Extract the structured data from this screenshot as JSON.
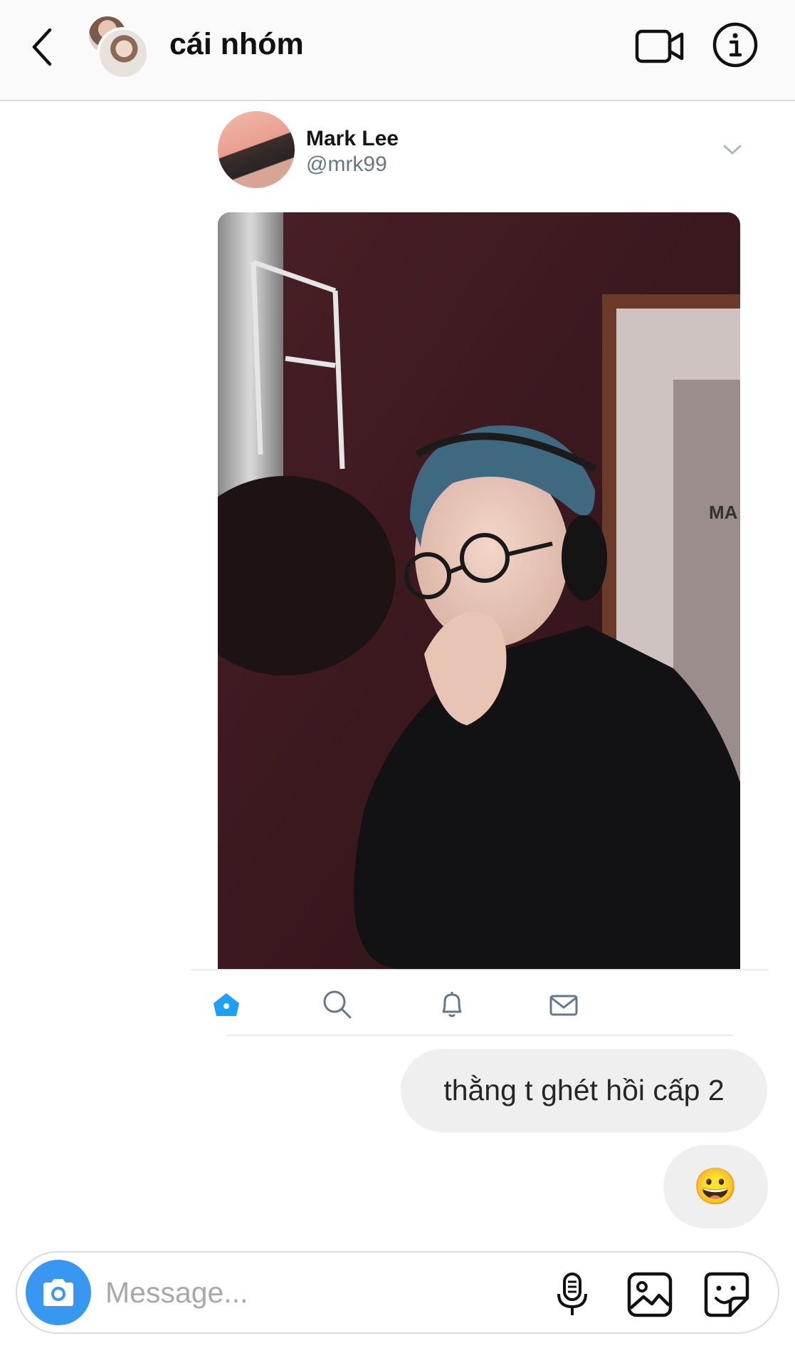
{
  "header": {
    "title": "cái nhóm",
    "back_icon": "chevron-left-icon",
    "video_icon": "video-camera-icon",
    "info_icon": "info-icon"
  },
  "tweet": {
    "name": "Mark Lee",
    "handle": "@mrk99",
    "photo_sign_text": "MA",
    "nav": [
      "home-icon",
      "search-icon",
      "bell-icon",
      "mail-icon"
    ],
    "accent": "#1da1f2"
  },
  "messages": [
    {
      "text": "thằng t ghét hồi cấp 2"
    },
    {
      "text": "😀"
    }
  ],
  "composer": {
    "placeholder": "Message...",
    "camera_color": "#3897f0"
  }
}
